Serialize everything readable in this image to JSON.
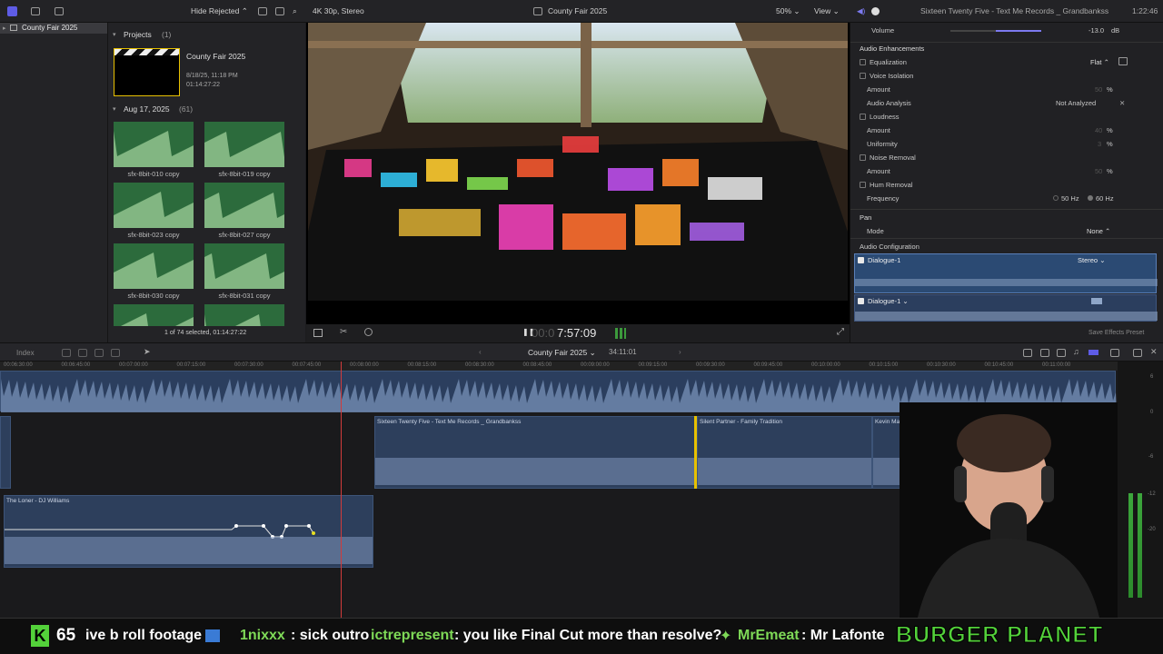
{
  "topbar": {
    "hide_rejected": "Hide Rejected",
    "format": "4K 30p, Stereo",
    "project_title": "County Fair 2025",
    "zoom": "50%",
    "view": "View",
    "track_title": "Sixteen Twenty Five - Text Me Records _ Grandbankss",
    "duration": "1:22:46"
  },
  "sidebar": {
    "items": [
      {
        "label": "County Fair 2025"
      }
    ]
  },
  "browser": {
    "projects_header": "Projects",
    "projects_count": "(1)",
    "project": {
      "name": "County Fair 2025",
      "date": "8/18/25, 11:18 PM",
      "duration": "01:14:27:22"
    },
    "date_group": "Aug 17, 2025",
    "date_count": "(61)",
    "clips": [
      {
        "label": "sfx-8bit-010 copy"
      },
      {
        "label": "sfx-8bit-019 copy"
      },
      {
        "label": "sfx-8bit-023 copy"
      },
      {
        "label": "sfx-8bit-027 copy"
      },
      {
        "label": "sfx-8bit-030 copy"
      },
      {
        "label": "sfx-8bit-031 copy"
      },
      {
        "label": ""
      },
      {
        "label": ""
      }
    ],
    "status": "1 of 74 selected, 01:14:27:22"
  },
  "viewer": {
    "timecode": "7:57:09",
    "timecode_dim": "00:0"
  },
  "inspector": {
    "volume_label": "Volume",
    "volume_value": "-13.0",
    "volume_unit": "dB",
    "audio_enhancements": "Audio Enhancements",
    "equalization": "Equalization",
    "equalization_value": "Flat",
    "voice_isolation": "Voice Isolation",
    "vi_amount": "Amount",
    "vi_amount_value": "50",
    "audio_analysis": "Audio Analysis",
    "audio_analysis_value": "Not Analyzed",
    "loudness": "Loudness",
    "loud_amount": "Amount",
    "loud_amount_value": "40",
    "uniformity": "Uniformity",
    "uniformity_value": "3",
    "noise_removal": "Noise Removal",
    "nr_amount": "Amount",
    "nr_amount_value": "50",
    "hum_removal": "Hum Removal",
    "frequency": "Frequency",
    "freq_50": "50 Hz",
    "freq_60": "60 Hz",
    "pan": "Pan",
    "mode": "Mode",
    "mode_value": "None",
    "audio_config": "Audio Configuration",
    "dialogue1": "Dialogue-1",
    "dialogue1_mode": "Stereo",
    "dialogue2": "Dialogue-1",
    "save_preset": "Save Effects Preset",
    "percent": "%"
  },
  "timeline_bar": {
    "index": "Index",
    "project": "County Fair 2025",
    "duration": "34:11:01"
  },
  "ruler": [
    "00:06:30:00",
    "00:06:45:00",
    "00:07:00:00",
    "00:07:15:00",
    "00:07:30:00",
    "00:07:45:00",
    "00:08:00:00",
    "00:08:15:00",
    "00:08:30:00",
    "00:08:45:00",
    "00:09:00:00",
    "00:09:15:00",
    "00:09:30:00",
    "00:09:45:00",
    "00:10:00:00",
    "00:10:15:00",
    "00:10:30:00",
    "00:10:45:00",
    "00:11:00:00"
  ],
  "clips": [
    {
      "title": "Sixteen Twenty Five - Text Me Records _ Grandbankss"
    },
    {
      "title": "Silent Partner - Family Tradition"
    },
    {
      "title": "Kevin MacLeod - Investigations"
    },
    {
      "title": "The Loner - DJ Williams"
    }
  ],
  "meter_labels": [
    "6",
    "0",
    "-6",
    "-12",
    "-20"
  ],
  "ticker": {
    "count": "65",
    "text1": "ive b roll footage",
    "user1": "1nixxx",
    "msg1": ": sick outro",
    "user2": "ictrepresent",
    "msg2": ": you like Final Cut more than resolve?",
    "user3": "MrEmeat",
    "msg3": ": Mr Lafonte",
    "brand": "BURGER PLANET"
  },
  "colors": {
    "accent": "#5e5ce6",
    "audio_clip": "#2d3f5c",
    "green_clip": "#2c6b3c",
    "ticker_green": "#7ed957"
  }
}
